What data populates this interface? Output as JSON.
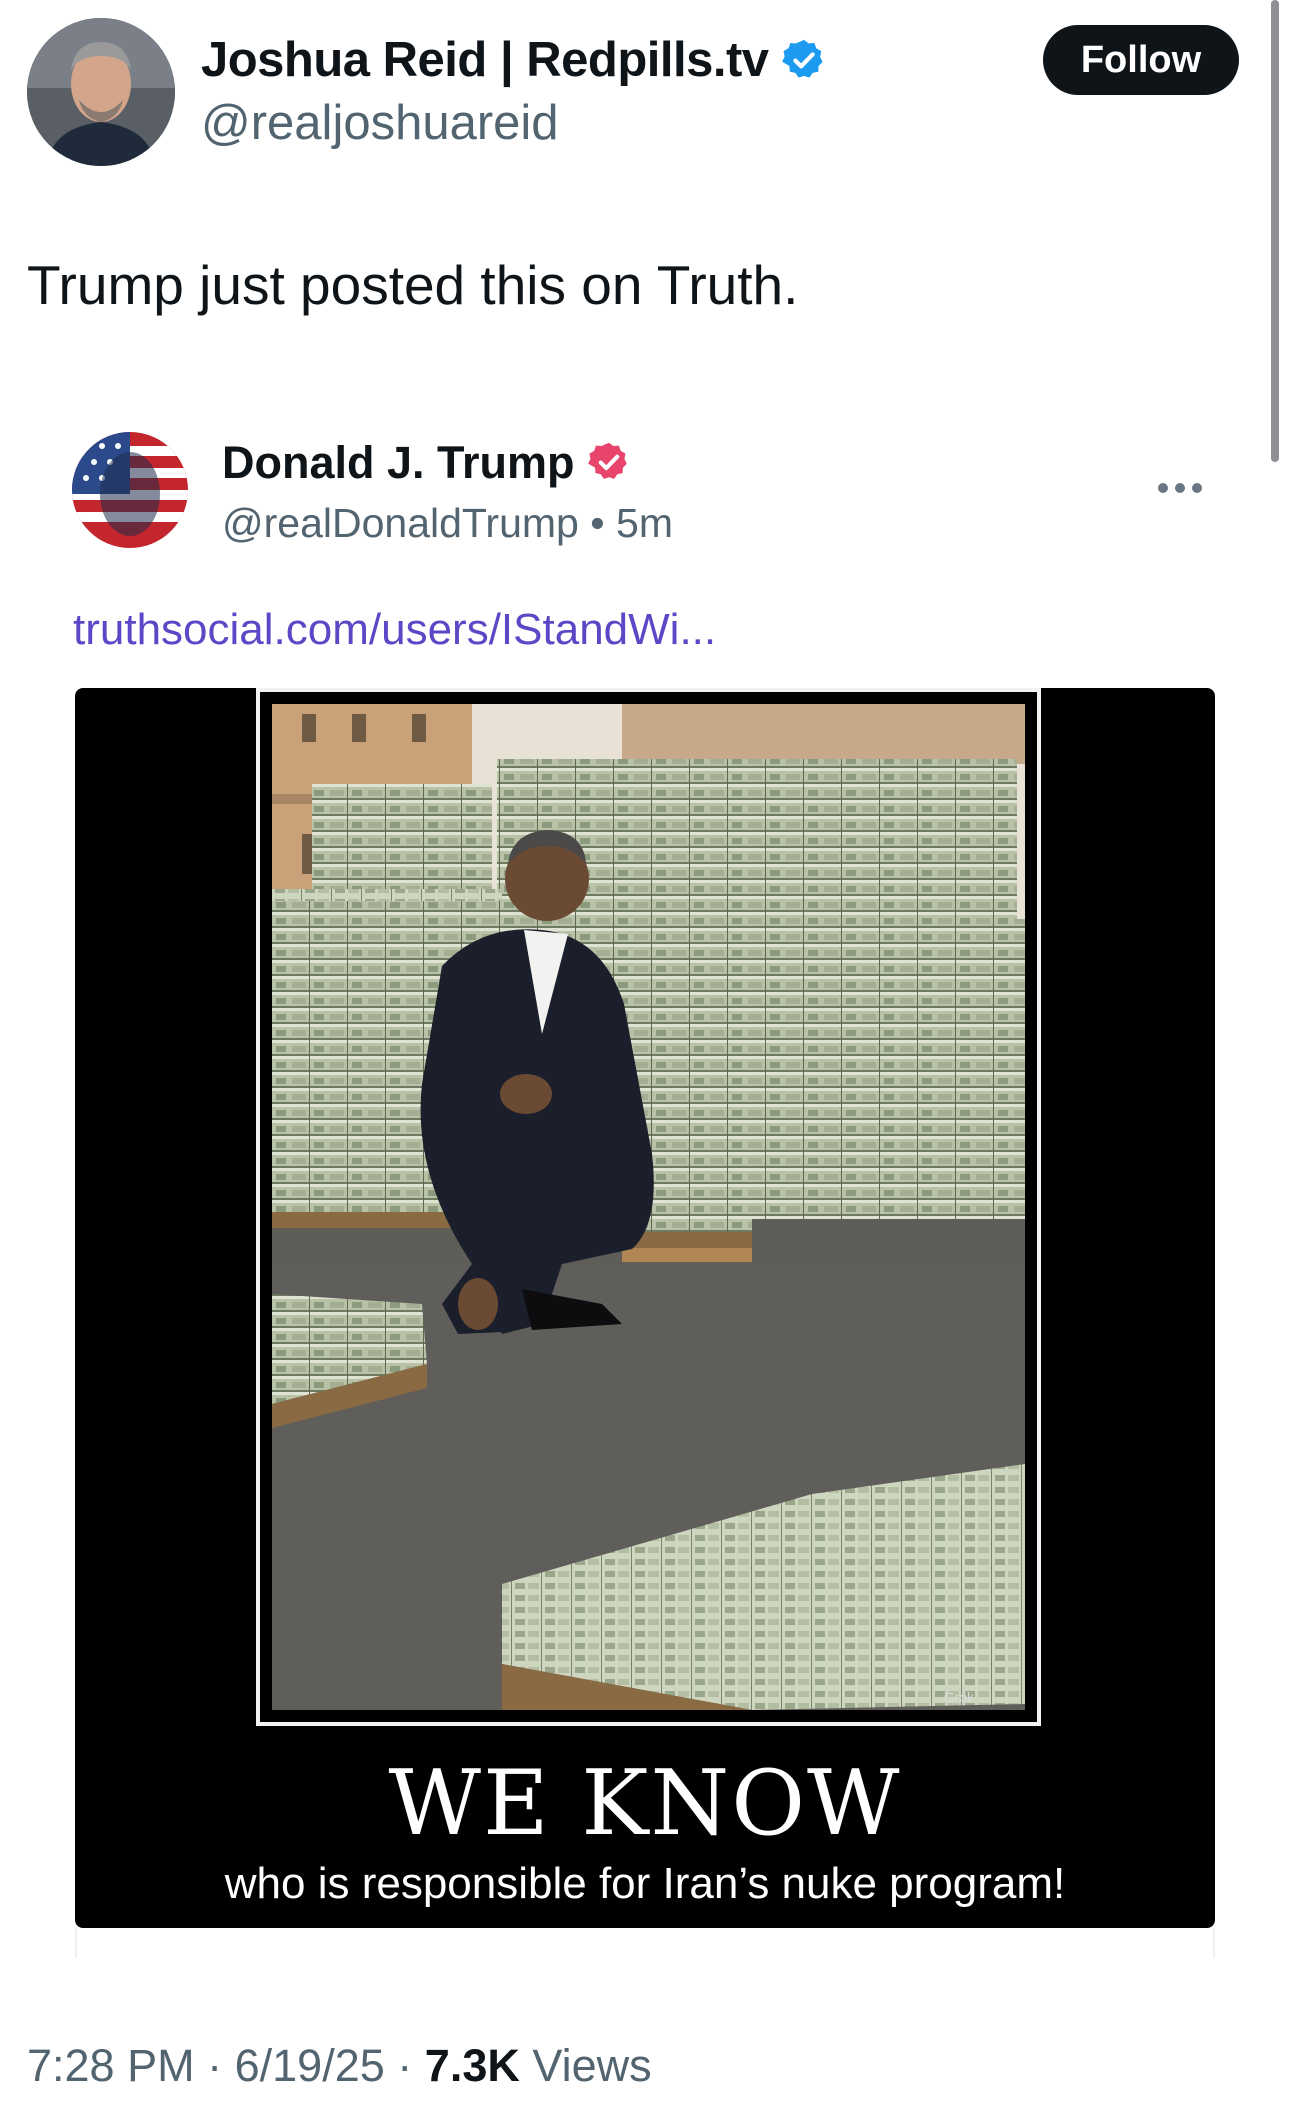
{
  "tweet": {
    "author_name": "Joshua Reid | Redpills.tv",
    "author_handle": "@realjoshuareid",
    "follow_label": "Follow",
    "text": "Trump just posted this on Truth.",
    "time": "7:28 PM",
    "date": "6/19/25",
    "views_count": "7.3K",
    "views_label": "Views",
    "separator": "·"
  },
  "embed": {
    "name": "Donald J. Trump",
    "handle": "@realDonaldTrump",
    "bullet": "•",
    "age": "5m",
    "link": "truthsocial.com/users/IStandWi...",
    "image_title": "WE KNOW",
    "image_subtitle": "who is responsible for Iran’s nuke program!",
    "watermark": "Grok"
  },
  "colors": {
    "x_verified": "#1d9bf0",
    "truth_verified": "#e8446c",
    "link": "#5b48c6",
    "follow_bg": "#0f1419"
  },
  "icons": {
    "verified": "verified-badge-icon",
    "truth_verified": "truth-verified-badge-icon",
    "more": "more-options-icon"
  }
}
